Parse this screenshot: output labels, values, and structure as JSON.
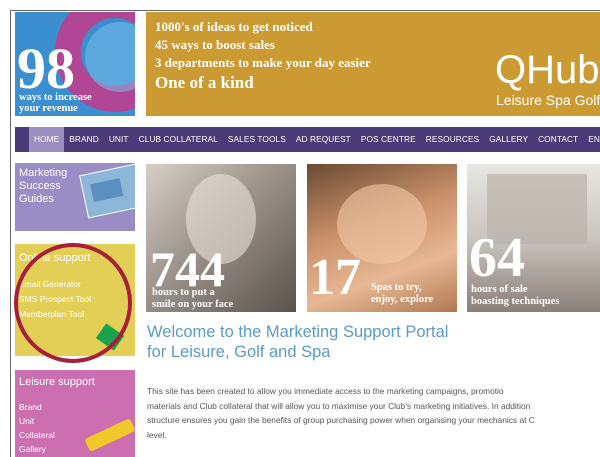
{
  "header": {
    "promo": {
      "number": "98",
      "caption_line1": "ways to increase",
      "caption_line2": "your revenue"
    },
    "banner": {
      "lines": [
        "1000's of ideas to get noticed",
        "45 ways to boost sales",
        "3 departments to make your day easier"
      ],
      "tagline": "One of a kind",
      "brand": "QHub",
      "brand_sub": "Leisure Spa Golf"
    }
  },
  "nav": {
    "items": [
      "HOME",
      "BRAND",
      "UNIT",
      "CLUB COLLATERAL",
      "SALES TOOLS",
      "AD REQUEST",
      "POS CENTRE",
      "RESOURCES",
      "GALLERY",
      "CONTACT",
      "ENJOY"
    ]
  },
  "sidebar": {
    "marketing": {
      "line1": "Marketing",
      "line2": "Success",
      "line3": "Guides"
    },
    "online": {
      "title": "Online support",
      "links": [
        "Email Generator",
        "SMS Prospect Tool",
        "Memberplan Tool"
      ]
    },
    "leisure": {
      "title": "Leisure support",
      "links": [
        "Brand",
        "Unit",
        "Collateral",
        "Gallery"
      ]
    }
  },
  "tiles": [
    {
      "number": "744",
      "caption_line1": "hours to put a",
      "caption_line2": "smile on your face"
    },
    {
      "number": "17",
      "caption_line1": "Spas to try,",
      "caption_line2": "enjoy, explore"
    },
    {
      "number": "64",
      "caption_line1": "hours of sale",
      "caption_line2": "boasting techniques"
    }
  ],
  "main": {
    "title_line1": "Welcome to the Marketing Support Portal",
    "title_line2": "for Leisure, Golf and Spa",
    "body_lines": [
      "This site has been created to allow you immediate access to the marketing campaigns, promotio",
      "materials and Club collateral that will allow you to maximise your Club's marketing initiatives. In addition",
      "structure ensures you gain the benefits of group purchasing power when organising your mechanics at C",
      "level."
    ]
  },
  "colors": {
    "nav_bg": "#4a3b78",
    "banner_gold": "#cc9a32",
    "online_yellow": "#e3cf55",
    "leisure_pink": "#cc6fb1",
    "marketing_lilac": "#9a8cc4",
    "title_blue": "#5b9ac9",
    "highlight_circle": "#a81f3a"
  }
}
